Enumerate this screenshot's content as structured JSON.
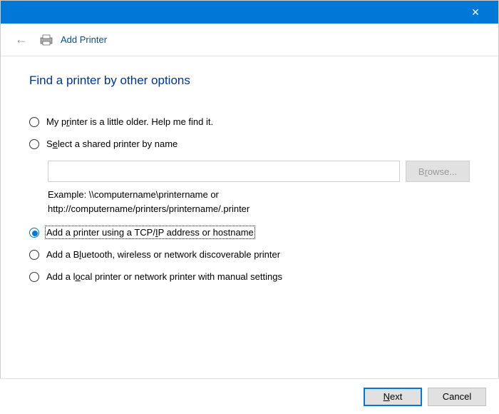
{
  "titlebar": {
    "close_label": "✕"
  },
  "header": {
    "back_glyph": "←",
    "title": "Add Printer"
  },
  "heading": "Find a printer by other options",
  "options": {
    "older_pre": "My p",
    "older_key": "r",
    "older_post": "inter is a little older. Help me find it.",
    "shared_pre": "S",
    "shared_key": "e",
    "shared_post": "lect a shared printer by name",
    "tcpip_pre": "Add a printer using a TCP/",
    "tcpip_key": "I",
    "tcpip_post": "P address or hostname",
    "bluetooth_pre": "Add a B",
    "bluetooth_key": "l",
    "bluetooth_post": "uetooth, wireless or network discoverable printer",
    "local_pre": "Add a l",
    "local_key": "o",
    "local_post": "cal printer or network printer with manual settings"
  },
  "shared": {
    "input_value": "",
    "browse_pre": "B",
    "browse_key": "r",
    "browse_post": "owse...",
    "example": "Example: \\\\computername\\printername or http://computername/printers/printername/.printer"
  },
  "footer": {
    "next_key": "N",
    "next_post": "ext",
    "cancel": "Cancel"
  }
}
